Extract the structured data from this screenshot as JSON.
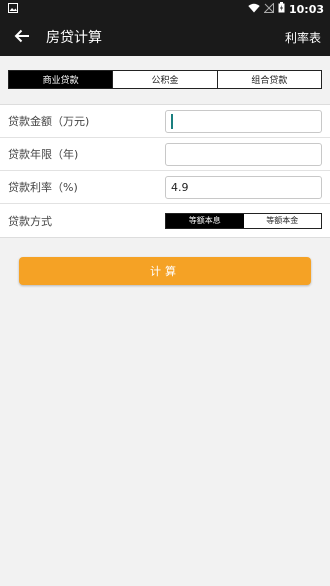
{
  "status_bar": {
    "time": "10:03"
  },
  "app_bar": {
    "title": "房贷计算",
    "action_label": "利率表"
  },
  "tabs": [
    {
      "label": "商业贷款",
      "active": true
    },
    {
      "label": "公积金",
      "active": false
    },
    {
      "label": "组合贷款",
      "active": false
    }
  ],
  "form": {
    "loan_amount_label": "贷款金额（万元)",
    "loan_amount_value": "",
    "loan_years_label": "贷款年限（年)",
    "loan_years_value": "",
    "interest_rate_label": "贷款利率（%)",
    "interest_rate_value": "4.9",
    "repay_method_label": "贷款方式",
    "repay_options": [
      {
        "label": "等额本息",
        "active": true
      },
      {
        "label": "等额本金",
        "active": false
      }
    ]
  },
  "calculate_label": "计算"
}
